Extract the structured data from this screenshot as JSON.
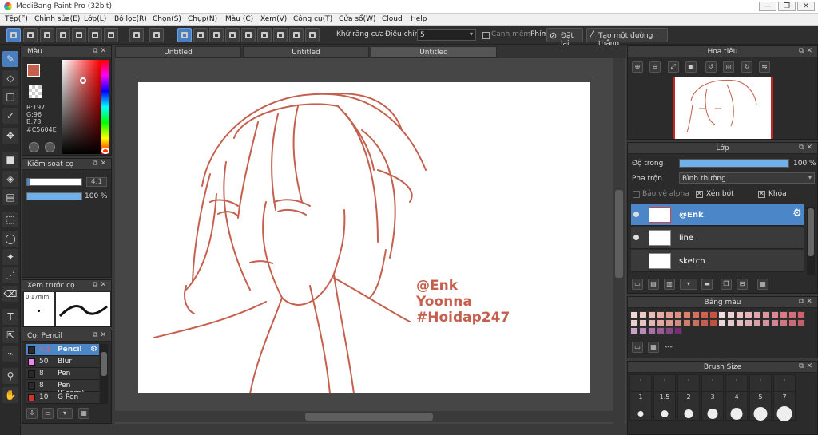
{
  "app": {
    "title": "MediBang Paint Pro (32bit)"
  },
  "window_controls": [
    "—",
    "❐",
    "✕"
  ],
  "menu": [
    "Tệp(F)",
    "Chỉnh sửa(E)",
    "Lớp(L)",
    "Bộ lọc(R)",
    "Chọn(S)",
    "Chụp(N)",
    "Màu (C)",
    "Xem(V)",
    "Công cụ(T)",
    "Cửa sổ(W)",
    "Cloud",
    "Help"
  ],
  "toolbar": {
    "antialias_label": "Khử răng cưa",
    "adjust_label": "Điều chỉnh",
    "adjust_value": "5",
    "edge_label": "Cạnh mềm",
    "key_label": "Phím",
    "reset_label": "Đặt lại",
    "straight_line_label": "Tạo một đường thẳng"
  },
  "color_panel": {
    "title": "Màu",
    "r": "R:197",
    "g": "G:96",
    "b": "B:78",
    "hex": "#C5604E",
    "current_color": "#c5604e"
  },
  "brush_control": {
    "title": "Kiểm soát cọ",
    "size": "4.1",
    "opacity": "100 %"
  },
  "brush_preview": {
    "title": "Xem trước cọ",
    "size_label": "0.17mm"
  },
  "brush_list": {
    "title": "Cọ: Pencil",
    "items": [
      {
        "size": "4.1",
        "name": "Pencil",
        "color": "#2a2a2a"
      },
      {
        "size": "50",
        "name": "Blur",
        "color": "#e88ae8"
      },
      {
        "size": "8",
        "name": "Pen",
        "color": "#2a2a2a"
      },
      {
        "size": "8",
        "name": "Pen (Sharp)",
        "color": "#2a2a2a"
      },
      {
        "size": "10",
        "name": "G Pen",
        "color": "#d63030"
      }
    ]
  },
  "tabs": [
    "Untitled",
    "Untitled",
    "Untitled"
  ],
  "canvas_text": {
    "line1": "@Enk",
    "line2": "Yoonna",
    "line3": "#Hoidap247"
  },
  "line_color": "#c5604e",
  "navigator": {
    "title": "Hoa tiêu"
  },
  "layer_panel": {
    "title": "Lớp",
    "opacity_label": "Độ trong",
    "opacity_value": "100 %",
    "opacity_fraction": 1.0,
    "blend_label": "Pha trộn",
    "blend_value": "Bình thường",
    "protect_alpha": "Bảo vệ alpha",
    "clipping": "Xén bớt",
    "lock": "Khóa",
    "layers": [
      "@Enk",
      "line",
      "sketch"
    ]
  },
  "palette": {
    "title": "Bảng màu",
    "more": "---"
  },
  "brush_size": {
    "title": "Brush Size",
    "labels": [
      "1",
      "1.5",
      "2",
      "3",
      "4",
      "5",
      "7"
    ]
  }
}
